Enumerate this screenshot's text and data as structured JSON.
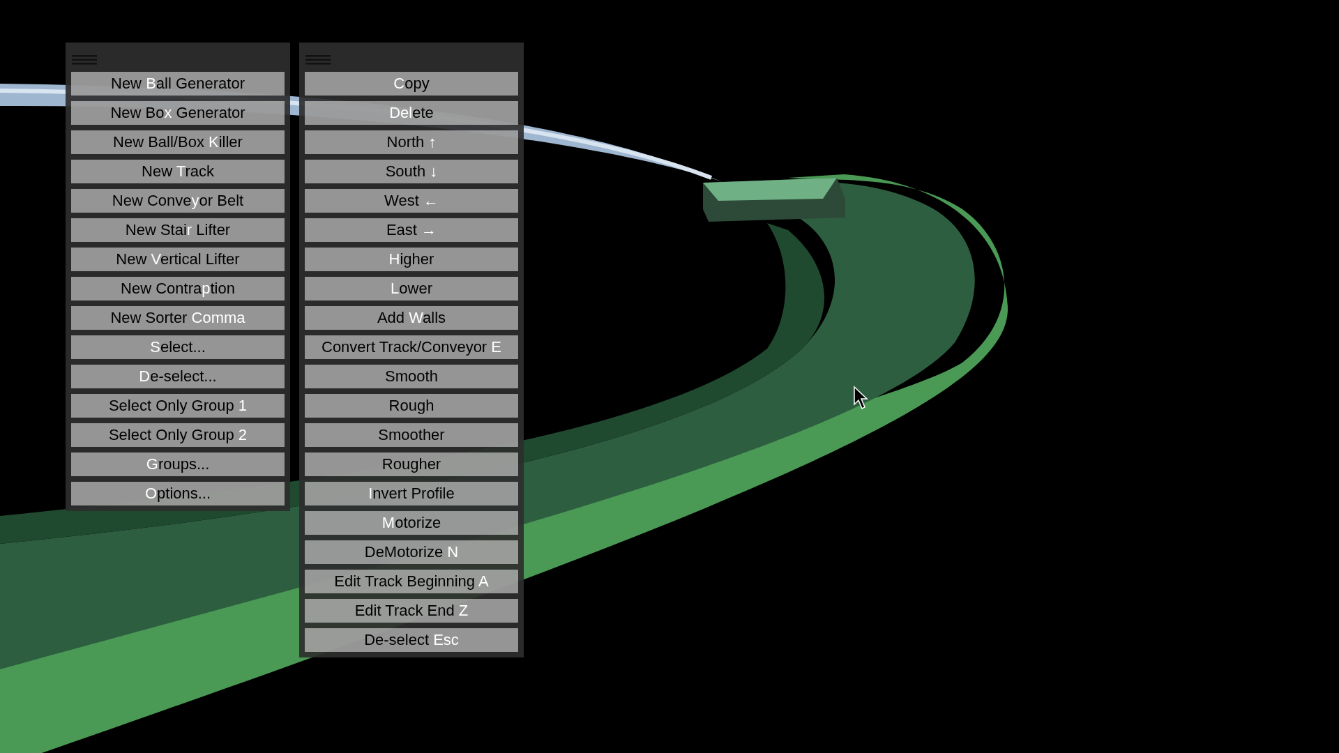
{
  "menus": [
    {
      "items": [
        "New **B**all Generator",
        "New Bo**x** Generator",
        "New Ball/Box **K**iller",
        "New **T**rack",
        "New Conve**y**or Belt",
        "New Stai**r** Lifter",
        "New **V**ertical Lifter",
        "New Contra**p**tion",
        "New Sorter **Comma**",
        "**S**elect...",
        "**D**e-select...",
        "Select Only Group **1**",
        "Select Only Group **2**",
        "**G**roups...",
        "**O**ptions..."
      ]
    },
    {
      "items": [
        "**C**opy",
        "**Del**ete",
        "North **↑**",
        "South **↓**",
        "West **←**",
        "East **→**",
        "**H**igher",
        "**L**ower",
        "Add **W**alls",
        "Convert Track/Conveyor **E**",
        "Smooth",
        "Rough",
        "Smoother",
        "Rougher",
        "**I**nvert Profile",
        "**M**otorize",
        "DeMotorize **N**",
        "Edit Track Beginning **A**",
        "Edit Track End **Z**",
        "De-select **Esc**"
      ]
    }
  ]
}
